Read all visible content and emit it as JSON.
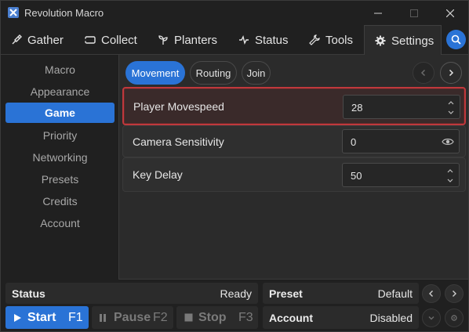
{
  "window": {
    "title": "Revolution Macro",
    "minimize_glyph": "—",
    "maximize_glyph": "☐",
    "close_glyph": "✕"
  },
  "tabs": [
    {
      "label": "Gather",
      "icon": "shovel-icon"
    },
    {
      "label": "Collect",
      "icon": "ticket-icon"
    },
    {
      "label": "Planters",
      "icon": "sprout-icon"
    },
    {
      "label": "Status",
      "icon": "pulse-icon"
    },
    {
      "label": "Tools",
      "icon": "wrench-icon"
    },
    {
      "label": "Settings",
      "icon": "gear-icon",
      "active": true
    }
  ],
  "sidebar": {
    "items": [
      {
        "label": "Macro"
      },
      {
        "label": "Appearance"
      },
      {
        "label": "Game",
        "active": true
      },
      {
        "label": "Priority"
      },
      {
        "label": "Networking"
      },
      {
        "label": "Presets"
      },
      {
        "label": "Credits"
      },
      {
        "label": "Account"
      }
    ]
  },
  "subtabs": [
    {
      "label": "Movement",
      "active": true
    },
    {
      "label": "Routing"
    },
    {
      "label": "Join"
    }
  ],
  "settings": [
    {
      "label": "Player Movespeed",
      "value": "28",
      "highlighted": true
    },
    {
      "label": "Camera Sensitivity",
      "value": "0"
    },
    {
      "label": "Key Delay",
      "value": "50"
    }
  ],
  "bottom": {
    "status_label": "Status",
    "status_value": "Ready",
    "preset_label": "Preset",
    "preset_value": "Default",
    "account_label": "Account",
    "account_value": "Disabled",
    "start_label": "Start",
    "start_key": "F1",
    "pause_label": "Pause",
    "pause_key": "F2",
    "stop_label": "Stop",
    "stop_key": "F3"
  },
  "colors": {
    "accent": "#2a73d6",
    "highlight_border": "#c0383c",
    "background": "#202020",
    "panel": "#2b2b2b"
  }
}
